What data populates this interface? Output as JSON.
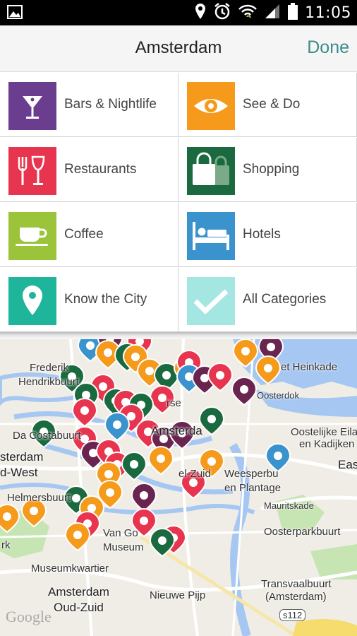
{
  "status_bar": {
    "time": "11:05"
  },
  "header": {
    "title": "Amsterdam",
    "done_label": "Done"
  },
  "categories": [
    {
      "label": "Bars & Nightlife",
      "icon": "cocktail-icon",
      "color": "#6a3d8f"
    },
    {
      "label": "See & Do",
      "icon": "eye-icon",
      "color": "#f59a1b"
    },
    {
      "label": "Restaurants",
      "icon": "fork-glass-icon",
      "color": "#e8354f"
    },
    {
      "label": "Shopping",
      "icon": "shopping-bags-icon",
      "color": "#1b6a3f"
    },
    {
      "label": "Coffee",
      "icon": "coffee-cup-icon",
      "color": "#9bc43a"
    },
    {
      "label": "Hotels",
      "icon": "bed-icon",
      "color": "#3a93cc"
    },
    {
      "label": "Know the City",
      "icon": "location-pin-icon",
      "color": "#1fb59b"
    },
    {
      "label": "All Categories",
      "icon": "checkmark-icon",
      "color": "#a4e6e2"
    }
  ],
  "map": {
    "labels": {
      "frederik": "Frederik",
      "hendrikbuurt": "Hendrikbuurt",
      "heinkade": "et Heinkade",
      "oosterdok": "Oosterdok",
      "dacosta": "Da Costabuurt",
      "oostelijke": "Oostelijke Eilan",
      "kadijken": "en Kadijken",
      "amsterdam_center": "Amsterda",
      "amsterdam_w": "sterdam",
      "dwest": "d-West",
      "east": "Eas",
      "weesperbuurt": "Weesperbu",
      "plantage": "en Plantage",
      "helmersbuurt": "Helmersbuurt",
      "mauritskade": "Mauritskade",
      "oosterparkbuurt": "Oosterparkbuurt",
      "rk": "rk",
      "vangogh": "Van Go",
      "museum": "Museum",
      "museumkwartier": "Museumkwartier",
      "transvaal": "Transvaalbuurt",
      "transvaal2": "(Amsterdam)",
      "amsterdam_oud": "Amsterdam",
      "oudzuid": "Oud-Zuid",
      "nieuwepijp": "Nieuwe Pijp",
      "zuid": "el-Zuid",
      "rse": "rse",
      "s112": "s112",
      "google": "Google"
    }
  }
}
